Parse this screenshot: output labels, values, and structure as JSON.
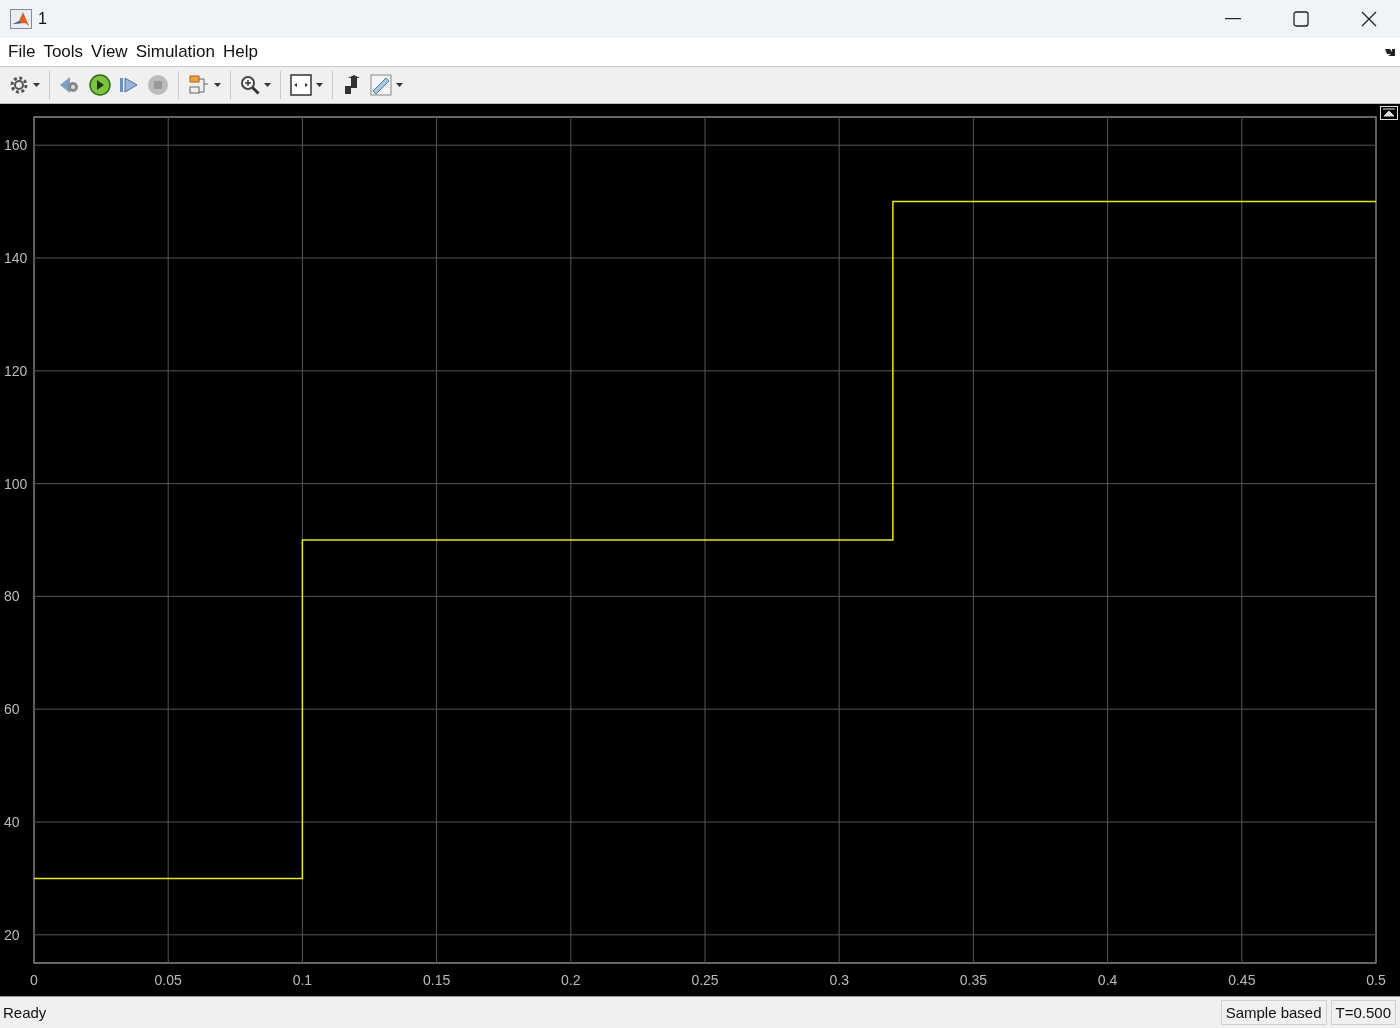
{
  "window": {
    "title": "1"
  },
  "menu": [
    "File",
    "Tools",
    "View",
    "Simulation",
    "Help"
  ],
  "toolbar": [
    {
      "kind": "gear",
      "dropdown": true
    },
    {
      "kind": "sep"
    },
    {
      "kind": "step-back",
      "dropdown": false
    },
    {
      "kind": "run",
      "dropdown": false
    },
    {
      "kind": "step-forward",
      "dropdown": false
    },
    {
      "kind": "stop",
      "dropdown": false,
      "disabled": true
    },
    {
      "kind": "sep"
    },
    {
      "kind": "signals",
      "dropdown": true
    },
    {
      "kind": "sep"
    },
    {
      "kind": "zoom",
      "dropdown": true
    },
    {
      "kind": "sep"
    },
    {
      "kind": "fit",
      "dropdown": true
    },
    {
      "kind": "sep"
    },
    {
      "kind": "highlight",
      "dropdown": false
    },
    {
      "kind": "ruler",
      "dropdown": true
    }
  ],
  "scope": {
    "chart_data": {
      "type": "line",
      "x": [
        0,
        0.1,
        0.1,
        0.32,
        0.32,
        0.5
      ],
      "series": [
        {
          "color": "#e8e81a",
          "values": [
            30,
            30,
            90,
            90,
            150,
            150
          ]
        }
      ],
      "grid": true,
      "xlim": [
        0,
        0.5
      ],
      "ylim": [
        15,
        165
      ],
      "xticks": [
        0,
        {
          "value": 0.05,
          "label": "0.05"
        },
        {
          "value": 0.1,
          "label": "0.1"
        },
        {
          "value": 0.15,
          "label": "0.15"
        },
        {
          "value": 0.2,
          "label": "0.2"
        },
        {
          "value": 0.25,
          "label": "0.25"
        },
        {
          "value": 0.3,
          "label": "0.3"
        },
        {
          "value": 0.35,
          "label": "0.35"
        },
        {
          "value": 0.4,
          "label": "0.4"
        },
        {
          "value": 0.45,
          "label": "0.45"
        },
        {
          "value": 0.5,
          "label": "0.5"
        }
      ],
      "yticks": [
        20,
        40,
        60,
        80,
        100,
        120,
        140,
        160
      ]
    }
  },
  "status_bar": {
    "message": "Ready",
    "mode": "Sample based",
    "time": "T=0.500"
  }
}
